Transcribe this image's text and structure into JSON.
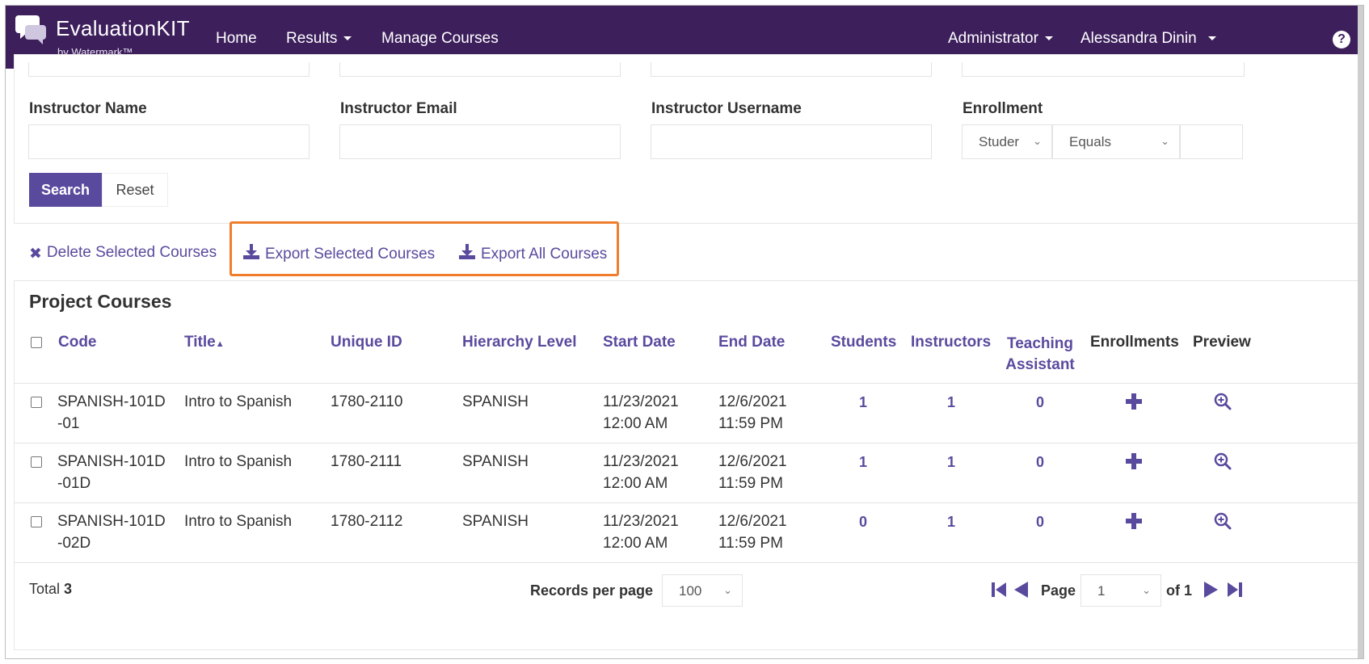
{
  "nav": {
    "brand": "EvaluationKIT",
    "brand_sub": "by Watermark™",
    "links": [
      "Home",
      "Results",
      "Manage Courses"
    ],
    "role": "Administrator",
    "user": "Alessandra Dinin",
    "help": "?"
  },
  "filters": {
    "instructor_name_label": "Instructor Name",
    "instructor_email_label": "Instructor Email",
    "instructor_username_label": "Instructor Username",
    "enrollment_label": "Enrollment",
    "enrollment_type_value": "Studer",
    "enrollment_operator_value": "Equals",
    "search_label": "Search",
    "reset_label": "Reset"
  },
  "actions": {
    "delete_selected": "Delete Selected Courses",
    "export_selected": "Export Selected Courses",
    "export_all": "Export All Courses",
    "highlight_color": "#f07d2c"
  },
  "table": {
    "title": "Project Courses",
    "columns": {
      "code": "Code",
      "title": "Title",
      "unique_id": "Unique ID",
      "hierarchy": "Hierarchy Level",
      "start": "Start Date",
      "end": "End Date",
      "students": "Students",
      "instructors": "Instructors",
      "ta_line1": "Teaching",
      "ta_line2": "Assistant",
      "enrollments": "Enrollments",
      "preview": "Preview"
    },
    "rows": [
      {
        "code1": "SPANISH-101D",
        "code2": "-01",
        "title": "Intro to Spanish",
        "uid": "1780-2110",
        "level": "SPANISH",
        "start1": "11/23/2021",
        "start2": "12:00 AM",
        "end1": "12/6/2021",
        "end2": "11:59 PM",
        "students": "1",
        "instructors": "1",
        "ta": "0"
      },
      {
        "code1": "SPANISH-101D",
        "code2": "-01D",
        "title": "Intro to Spanish",
        "uid": "1780-2111",
        "level": "SPANISH",
        "start1": "11/23/2021",
        "start2": "12:00 AM",
        "end1": "12/6/2021",
        "end2": "11:59 PM",
        "students": "1",
        "instructors": "1",
        "ta": "0"
      },
      {
        "code1": "SPANISH-101D",
        "code2": "-02D",
        "title": "Intro to Spanish",
        "uid": "1780-2112",
        "level": "SPANISH",
        "start1": "11/23/2021",
        "start2": "12:00 AM",
        "end1": "12/6/2021",
        "end2": "11:59 PM",
        "students": "0",
        "instructors": "1",
        "ta": "0"
      }
    ]
  },
  "footer": {
    "total_label": "Total",
    "total_value": "3",
    "records_label": "Records per page",
    "records_value": "100",
    "page_label": "Page",
    "page_value": "1",
    "of_label": "of 1"
  },
  "colors": {
    "nav_bg": "#3d1f5c",
    "accent": "#5a4a9e"
  }
}
